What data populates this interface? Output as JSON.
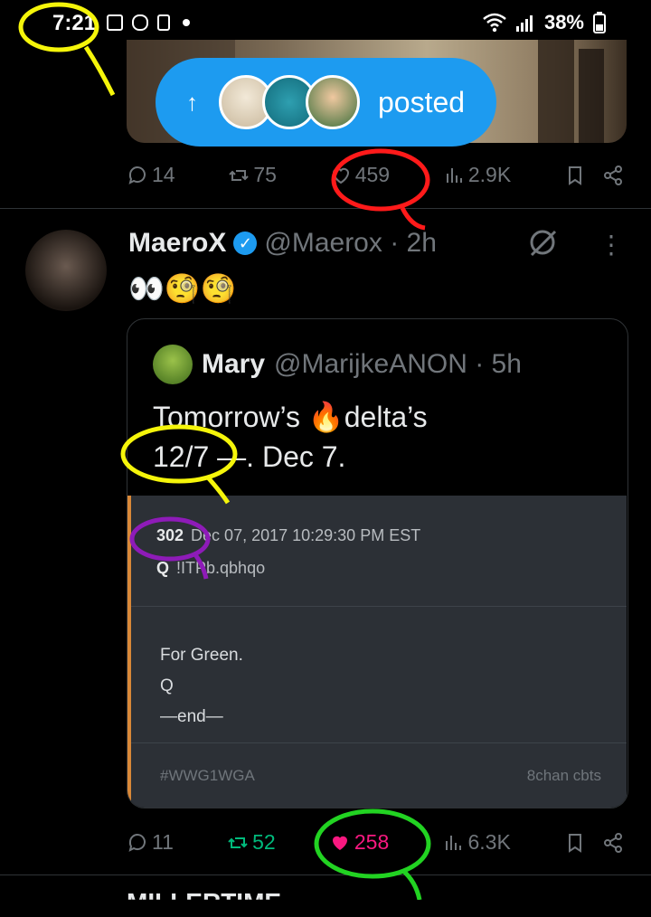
{
  "status": {
    "time": "7:21",
    "battery": "38%"
  },
  "banner": {
    "arrow": "↑",
    "label": "posted"
  },
  "prev_tweet": {
    "replies": "14",
    "retweets": "75",
    "likes": "459",
    "views": "2.9K"
  },
  "tweet": {
    "name": "MaeroX",
    "verified": "✓",
    "handle": "@Maerox · 2h",
    "text": "👀🧐🧐",
    "more": "⋮"
  },
  "quote": {
    "name": "Mary",
    "handle": "@MarijkeANON · 5h",
    "line1": "Tomorrow’s 🔥delta’s",
    "line2": "12/7 —. Dec 7.",
    "card": {
      "post_num": "302",
      "date": "Dec 07, 2017 10:29:30 PM EST",
      "author": "Q",
      "trip": "!ITPb.qbhqo",
      "body_l1": "For Green.",
      "body_l2": "Q",
      "body_l3": "—end—",
      "footer_left": "#WWG1WGA",
      "footer_right": "8chan cbts"
    }
  },
  "actions": {
    "replies": "11",
    "retweets": "52",
    "likes": "258",
    "views": "6.3K"
  },
  "colors": {
    "accent": "#1d9bf0",
    "like_active": "#f91880",
    "retweet_active": "#00ba7c",
    "annotation_yellow": "#f5f50a",
    "annotation_red": "#ff1a1a",
    "annotation_purple": "#8e1bb8",
    "annotation_green": "#22d322"
  },
  "next_tweet": {
    "name": "MILLERTIME"
  }
}
